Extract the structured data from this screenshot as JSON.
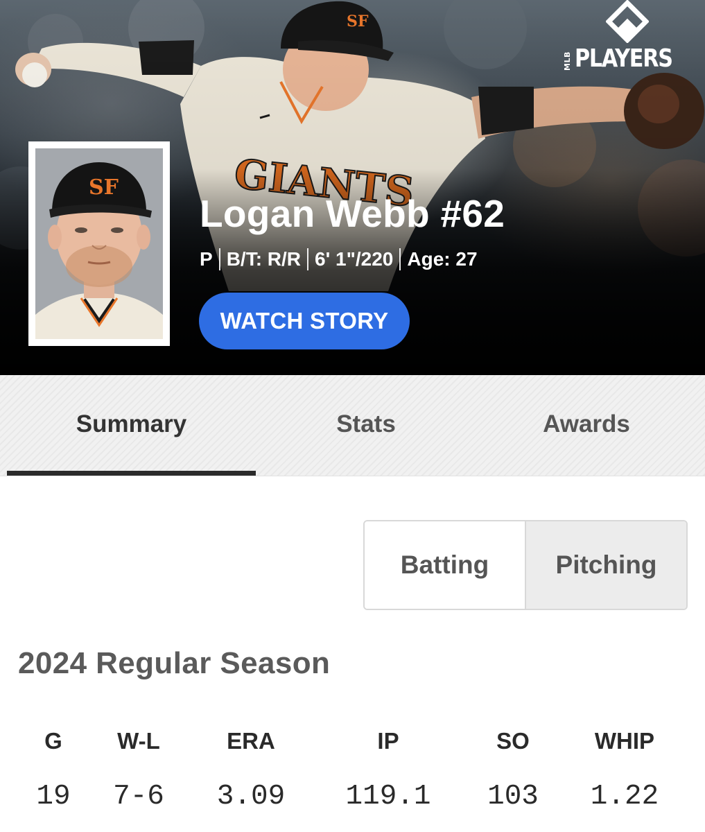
{
  "brand": {
    "label_small": "MLB",
    "label_large": "PLAYERS"
  },
  "player": {
    "name": "Logan Webb #62",
    "position": "P",
    "bats_throws": "B/T: R/R",
    "height_weight": "6' 1\"/220",
    "age": "Age: 27"
  },
  "hero": {
    "watch_label": "WATCH STORY"
  },
  "tabs": [
    {
      "label": "Summary",
      "active": true
    },
    {
      "label": "Stats",
      "active": false
    },
    {
      "label": "Awards",
      "active": false
    }
  ],
  "toggle": {
    "batting": "Batting",
    "pitching": "Pitching",
    "selected": "Pitching"
  },
  "season": {
    "title": "2024 Regular Season",
    "stats": [
      {
        "label": "G",
        "value": "19"
      },
      {
        "label": "W-L",
        "value": "7-6"
      },
      {
        "label": "ERA",
        "value": "3.09"
      },
      {
        "label": "IP",
        "value": "119.1"
      },
      {
        "label": "SO",
        "value": "103"
      },
      {
        "label": "WHIP",
        "value": "1.22"
      }
    ]
  },
  "colors": {
    "accent": "#2e6de3",
    "team_orange": "#e8762b",
    "tab_underline": "#2b2b2b"
  }
}
